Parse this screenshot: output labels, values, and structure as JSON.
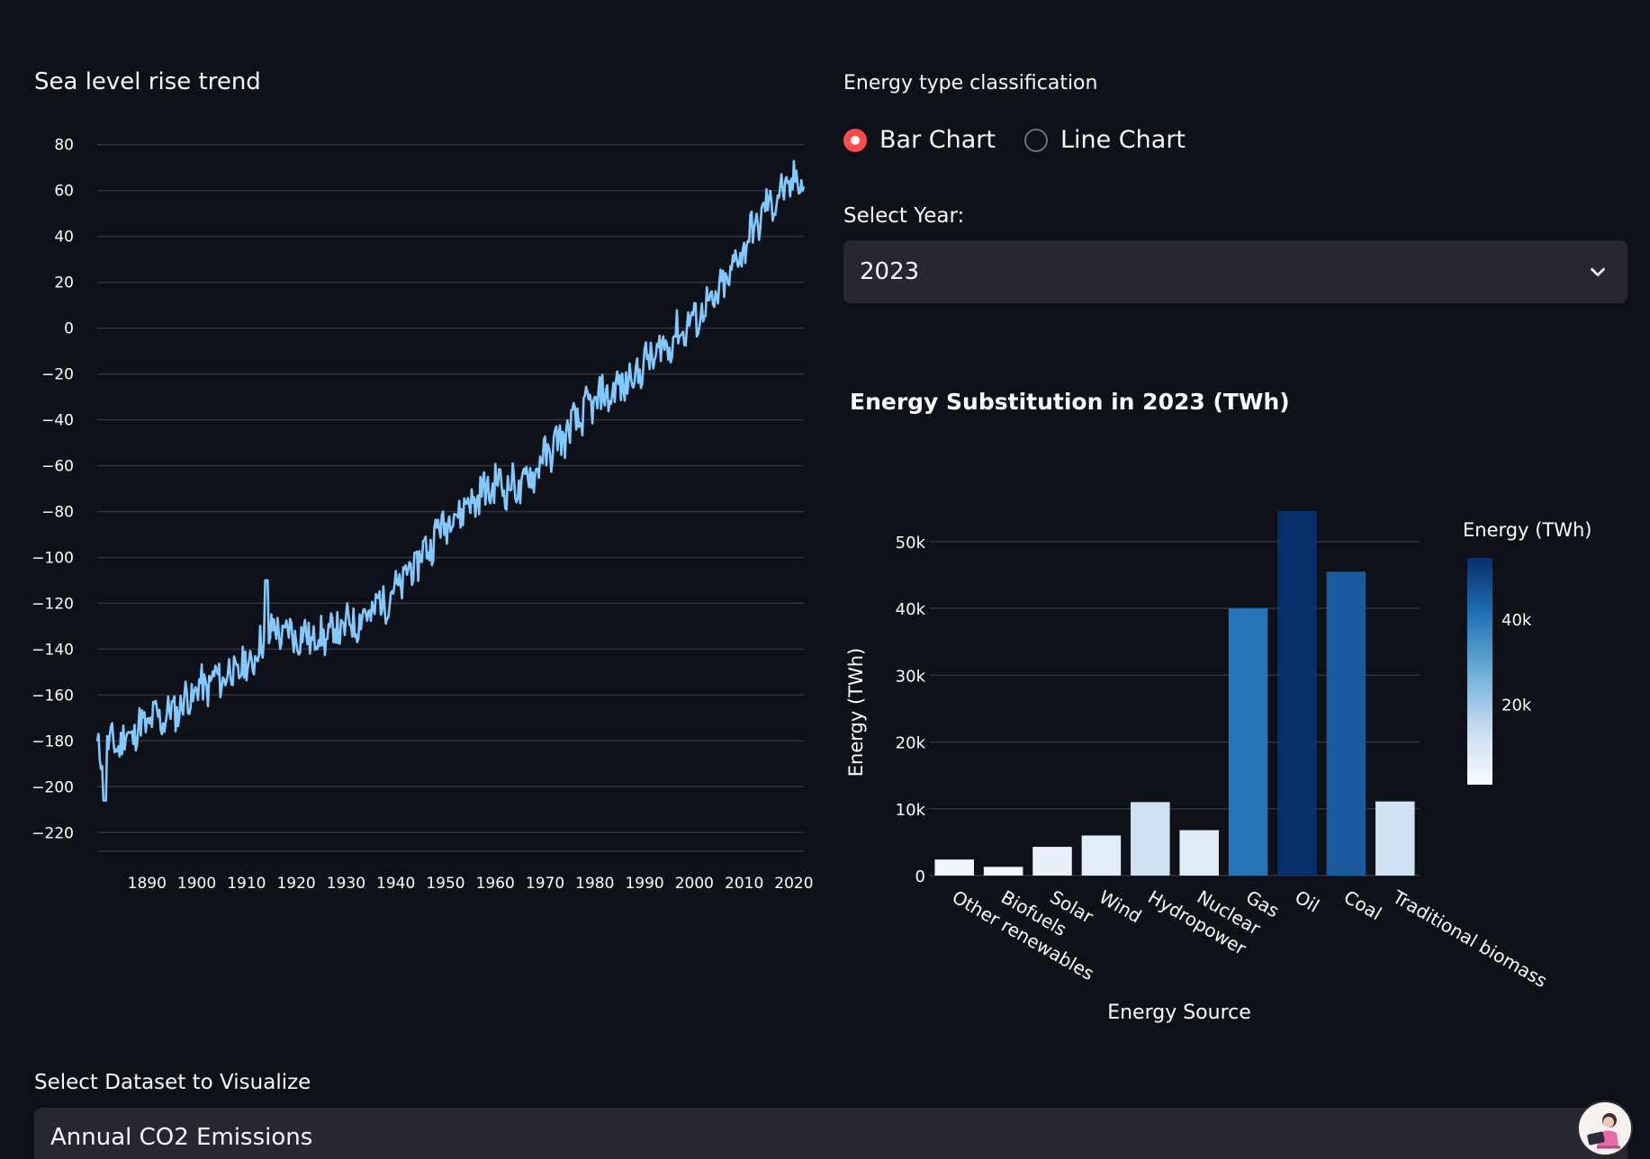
{
  "sea_level": {
    "title": "Sea level rise trend"
  },
  "energy": {
    "type_label": "Energy type classification",
    "radio_options": [
      {
        "label": "Bar Chart",
        "checked": true
      },
      {
        "label": "Line Chart",
        "checked": false
      }
    ],
    "year_label": "Select Year:",
    "year_value": "2023",
    "colorbar_title": "Energy (TWh)",
    "colorbar_ticks": [
      "20k",
      "40k"
    ]
  },
  "dataset": {
    "label": "Select Dataset to Visualize",
    "value": "Annual CO2 Emissions"
  },
  "icons": {
    "dropdown": "chevron-down-icon",
    "avatar": "avatar"
  },
  "colors": {
    "background": "#0e1117",
    "widget_bg": "#262730",
    "radio_accent": "#ff4b4b",
    "line": "#83c9ff"
  },
  "chart_data": [
    {
      "type": "line",
      "title": "",
      "xlabel": "",
      "ylabel": "",
      "ylim": [
        -225,
        85
      ],
      "xlim": [
        1880,
        2022
      ],
      "x_ticks": [
        1890,
        1900,
        1910,
        1920,
        1930,
        1940,
        1950,
        1960,
        1970,
        1980,
        1990,
        2000,
        2010,
        2020
      ],
      "y_ticks": [
        80,
        60,
        40,
        20,
        0,
        -20,
        -40,
        -60,
        -80,
        -100,
        -120,
        -140,
        -160,
        -180,
        -200,
        -220
      ],
      "grid": true,
      "x": [
        1880,
        1885,
        1890,
        1895,
        1900,
        1905,
        1910,
        1915,
        1920,
        1925,
        1930,
        1935,
        1940,
        1945,
        1950,
        1955,
        1960,
        1965,
        1970,
        1975,
        1980,
        1985,
        1990,
        1995,
        2000,
        2005,
        2010,
        2015,
        2021
      ],
      "y": [
        -185,
        -180,
        -172,
        -168,
        -158,
        -152,
        -148,
        -132,
        -134,
        -135,
        -130,
        -124,
        -114,
        -100,
        -84,
        -76,
        -68,
        -70,
        -56,
        -44,
        -32,
        -26,
        -16,
        -6,
        4,
        14,
        36,
        54,
        65
      ]
    },
    {
      "type": "bar",
      "title": "Energy Substitution in 2023 (TWh)",
      "xlabel": "Energy Source",
      "ylabel": "Energy (TWh)",
      "categories": [
        "Other renewables",
        "Biofuels",
        "Solar",
        "Wind",
        "Hydropower",
        "Nuclear",
        "Gas",
        "Oil",
        "Coal",
        "Traditional biomass"
      ],
      "values": [
        2400,
        1300,
        4300,
        6000,
        11000,
        6800,
        40000,
        54600,
        45500,
        11100
      ],
      "y_ticks": [
        "0",
        "10k",
        "20k",
        "30k",
        "40k",
        "50k"
      ],
      "ylim": [
        0,
        57000
      ],
      "grid": true,
      "colorscale": "Blues",
      "legend": "colorbar right"
    }
  ]
}
